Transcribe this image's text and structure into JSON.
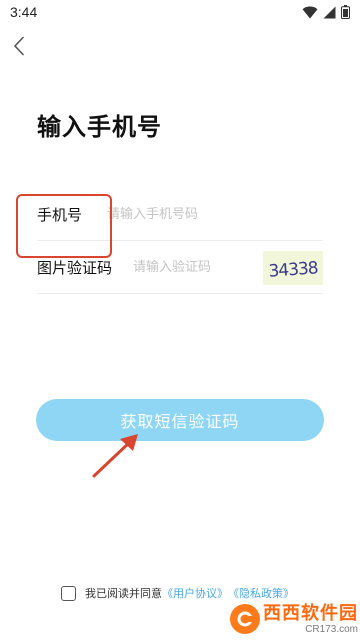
{
  "status_bar": {
    "time": "3:44",
    "icons": [
      "wifi-icon",
      "signal-icon",
      "battery-icon"
    ]
  },
  "header": {
    "back_icon": "chevron-left-icon"
  },
  "page": {
    "title": "输入手机号"
  },
  "form": {
    "phone": {
      "label": "手机号",
      "placeholder": "请输入手机号码",
      "value": ""
    },
    "captcha": {
      "label": "图片验证码",
      "placeholder": "请输入验证码",
      "value": "",
      "image_text": "34338"
    }
  },
  "submit": {
    "label": "获取短信验证码"
  },
  "agreement": {
    "checked": false,
    "text": "我已阅读并同意",
    "user_agreement": "《用户协议》",
    "privacy_policy": "《隐私政策》"
  },
  "watermark": {
    "title": "西西软件园",
    "sub": "CR173.com"
  },
  "colors": {
    "button": "#8fd6f5",
    "highlight": "#d9452f",
    "link": "#4aa8e8",
    "watermark": "#ff6a10"
  }
}
